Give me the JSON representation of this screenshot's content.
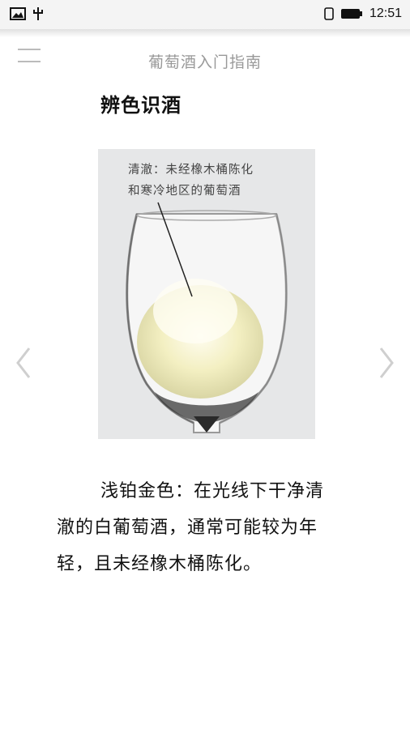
{
  "status_bar": {
    "time": "12:51",
    "icons": [
      "image-icon",
      "usb-icon",
      "vibrate-icon",
      "battery-icon"
    ]
  },
  "header": {
    "title": "葡萄酒入门指南",
    "menu_icon": "hamburger-menu-icon"
  },
  "page": {
    "heading": "辨色识酒",
    "image": {
      "callout_line1": "清澈：未经橡木桶陈化",
      "callout_line2": "和寒冷地区的葡萄酒",
      "wine_color": "#f3efbf"
    },
    "description": "浅铂金色：在光线下干净清澈的白葡萄酒，通常可能较为年轻，且未经橡木桶陈化。",
    "nav": {
      "prev_icon": "chevron-left-icon",
      "next_icon": "chevron-right-icon"
    }
  }
}
